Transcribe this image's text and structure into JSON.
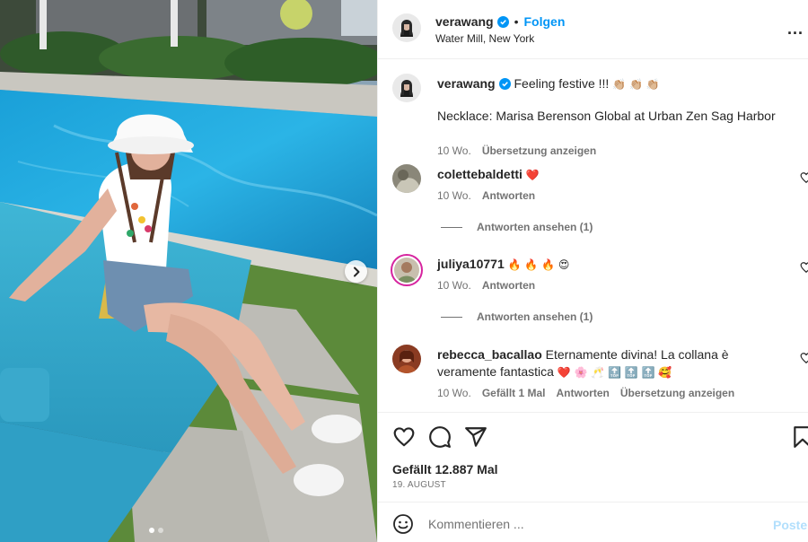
{
  "post": {
    "author": "verawang",
    "follow_label": "Folgen",
    "separator": "•",
    "location": "Water Mill, New York",
    "more_label": "...",
    "caption_text": "Feeling festive !!! ",
    "caption_emojis": "👏🏼 👏🏼 👏🏼",
    "caption_line2": "Necklace: Marisa Berenson Global at Urban Zen Sag Harbor",
    "caption_time": "10 Wo.",
    "caption_translate": "Übersetzung anzeigen"
  },
  "comments": [
    {
      "username": "colettebaldetti",
      "text": "",
      "emojis": "❤️",
      "time": "10 Wo.",
      "reply_label": "Antworten",
      "view_replies": "Antworten ansehen (1)"
    },
    {
      "username": "juliya10771",
      "text": "",
      "emojis": "🔥 🔥 🔥 😍",
      "time": "10 Wo.",
      "reply_label": "Antworten",
      "view_replies": "Antworten ansehen (1)"
    },
    {
      "username": "rebecca_bacallao",
      "text": "Eternamente divina! La collana è veramente fantastica",
      "emojis": "❤️ 🌸 🥂 🔝 🔝 🔝 🥰",
      "time": "10 Wo.",
      "likes_label": "Gefällt 1 Mal",
      "reply_label": "Antworten",
      "translate_label": "Übersetzung anzeigen"
    }
  ],
  "actions": {
    "like_icon": "heart-icon",
    "comment_icon": "comment-icon",
    "share_icon": "share-icon",
    "save_icon": "bookmark-icon"
  },
  "likes": "Gefällt 12.887 Mal",
  "date": "19. AUGUST",
  "add_comment": {
    "placeholder": "Kommentieren ...",
    "post_label": "Posten",
    "emoji_icon": "smiley-icon"
  },
  "carousel": {
    "next_icon": "chevron-right-icon",
    "slide_count": 2,
    "active_slide": 1
  },
  "colors": {
    "accent": "#0095f6",
    "verified": "#0095f6",
    "secondary_text": "#737373",
    "post_disabled": "#b2dffc"
  }
}
